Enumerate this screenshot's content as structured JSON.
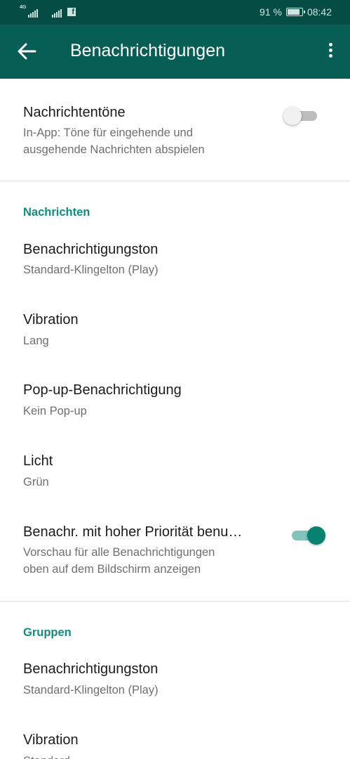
{
  "status_bar": {
    "network_label": "4G",
    "fb_glyph": "f",
    "battery_text": "91 %",
    "battery_level": 0.91,
    "time": "08:42"
  },
  "app_bar": {
    "title": "Benachrichtigungen",
    "back_icon": "arrow-left-icon",
    "menu_icon": "more-vert-icon",
    "color": "#075e54",
    "status_color": "#054d44"
  },
  "conversation_tones": {
    "title": "Nachrichtentöne",
    "subtitle_line1": "In-App: Töne für eingehende und",
    "subtitle_line2": "ausgehende Nachrichten abspielen",
    "enabled": false
  },
  "messages_section": {
    "header": "Nachrichten",
    "notification_tone": {
      "title": "Benachrichtigungston",
      "value": "Standard-Klingelton (Play)"
    },
    "vibration": {
      "title": "Vibration",
      "value": "Lang"
    },
    "popup": {
      "title": "Pop-up-Benachrichtigung",
      "value": "Kein Pop-up"
    },
    "light": {
      "title": "Licht",
      "value": "Grün"
    },
    "high_priority": {
      "title": "Benachr. mit hoher Priorität benu…",
      "subtitle_line1": "Vorschau für alle Benachrichtigungen",
      "subtitle_line2": "oben auf dem Bildschirm anzeigen",
      "enabled": true
    }
  },
  "groups_section": {
    "header": "Gruppen",
    "notification_tone": {
      "title": "Benachrichtigungston",
      "value": "Standard-Klingelton (Play)"
    },
    "vibration": {
      "title": "Vibration",
      "value": "Standard"
    }
  },
  "colors": {
    "accent": "#128c7e",
    "toggle_on": "#078170"
  }
}
